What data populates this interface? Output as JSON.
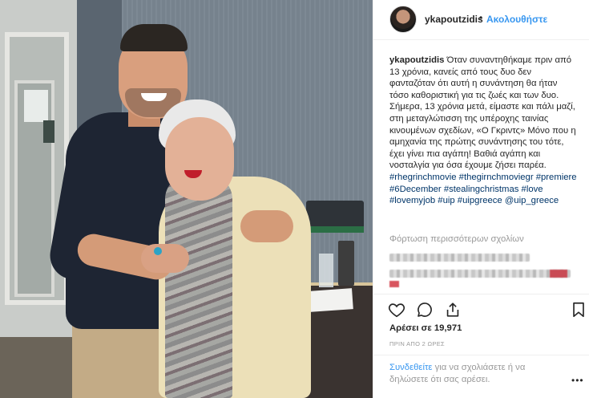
{
  "header": {
    "username": "ykapoutzidis",
    "separator": "•",
    "follow_label": "Ακολουθήστε",
    "avatar_icon": "profile-avatar"
  },
  "caption": {
    "username": "ykapoutzidis",
    "text": "Όταν συναντηθήκαμε πριν από 13 χρόνια, κανείς από τους δυο δεν φανταζόταν ότι αυτή η συνάντηση θα ήταν τόσο καθοριστική για τις ζωές και των δυο. Σήμερα, 13 χρόνια μετά, είμαστε και πάλι μαζί, στη μεταγλώτισση της υπέροχης ταινίας κινουμένων σχεδίων, «Ο Γκριντς» Μόνο που η αμηχανία της πρώτης συνάντησης του τότε, έχει γίνει πια αγάπη! Βαθιά αγάπη και νοσταλγία για όσα έχουμε ζήσει παρέα.",
    "hashtags": [
      "#rhegrinchmovie",
      "#thegirnchmoviegr",
      "#premiere",
      "#6December",
      "#stealingchristmas",
      "#love",
      "#lovemyjob",
      "#uip",
      "#uipgreece",
      "@uip_greece"
    ]
  },
  "comments": {
    "load_more_label": "Φόρτωση περισσότερων σχολίων"
  },
  "actions": {
    "like_icon": "heart-icon",
    "comment_icon": "comment-icon",
    "share_icon": "share-icon",
    "save_icon": "bookmark-icon"
  },
  "likes": {
    "text": "Αρέσει σε 19,971"
  },
  "timestamp": {
    "text": "ΠΡΙΝ ΑΠΟ 2 ΩΡΕΣ"
  },
  "footer": {
    "login_link": "Συνδεθείτε",
    "login_text": " για να σχολιάσετε ή να δηλώσετε ότι σας αρέσει.",
    "more_label": "•••"
  },
  "colors": {
    "link_blue": "#3897f0",
    "hashtag": "#003569",
    "muted": "#999999"
  }
}
